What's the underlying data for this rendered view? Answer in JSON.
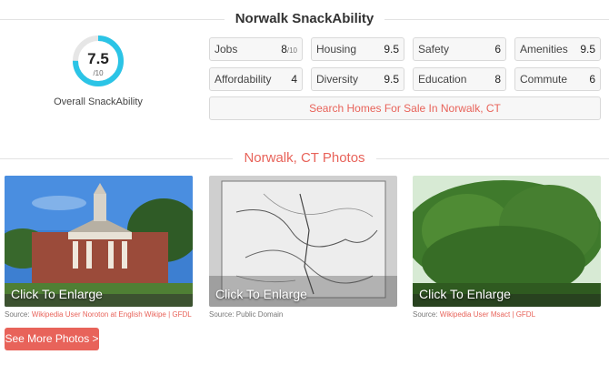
{
  "snackability": {
    "title": "Norwalk SnackAbility",
    "overall_score": "7.5",
    "overall_max": "/10",
    "overall_fraction": 0.75,
    "overall_label": "Overall SnackAbility",
    "accent_color": "#2bc4e6",
    "metrics": [
      {
        "name": "Jobs",
        "value": "8",
        "suffix": "/10"
      },
      {
        "name": "Housing",
        "value": "9.5",
        "suffix": ""
      },
      {
        "name": "Safety",
        "value": "6",
        "suffix": ""
      },
      {
        "name": "Amenities",
        "value": "9.5",
        "suffix": ""
      },
      {
        "name": "Affordability",
        "value": "4",
        "suffix": ""
      },
      {
        "name": "Diversity",
        "value": "9.5",
        "suffix": ""
      },
      {
        "name": "Education",
        "value": "8",
        "suffix": ""
      },
      {
        "name": "Commute",
        "value": "6",
        "suffix": ""
      }
    ],
    "search_button": "Search Homes For Sale In Norwalk, CT"
  },
  "photos": {
    "title": "Norwalk, CT Photos",
    "enlarge_label": "Click To Enlarge",
    "items": [
      {
        "source_prefix": "Source:",
        "source_link": "Wikipedia User Noroton at English Wikipe | GFDL"
      },
      {
        "source_prefix": "Source: Public Domain",
        "source_link": ""
      },
      {
        "source_prefix": "Source:",
        "source_link": "Wikipedia User Msact | GFDL"
      }
    ],
    "see_more": "See More Photos >"
  }
}
